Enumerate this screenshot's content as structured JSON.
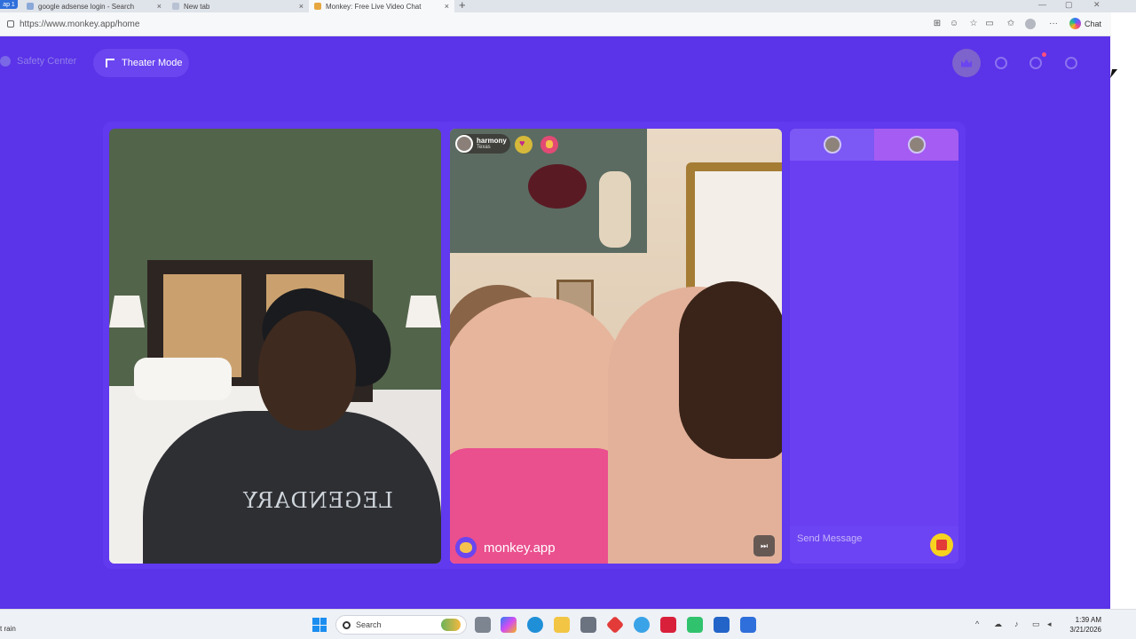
{
  "browser": {
    "tab_badge": "ap 1",
    "tabs": [
      {
        "title": "google adsense login - Search",
        "close": "×"
      },
      {
        "title": "New tab",
        "close": "×"
      },
      {
        "title": "Monkey: Free Live Video Chat",
        "close": "×"
      }
    ],
    "new_tab": "+",
    "url": "https://www.monkey.app/home",
    "chat_label": "Chat",
    "more": "···"
  },
  "page": {
    "safety_center": "Safety Center",
    "theater_mode": "Theater Mode",
    "remote_user": {
      "name": "harmony",
      "location": "Texas"
    },
    "watermark": "monkey.app",
    "next_symbol": "⏭",
    "shirt_text": "LEGENDARY",
    "chat": {
      "placeholder": "Send Message"
    }
  },
  "taskbar": {
    "weather": "t rain",
    "search": "Search",
    "time": "1:39 AM",
    "date": "3/21/2026"
  },
  "colors": {
    "page_bg": "#5b33e8",
    "accent": "#6a45f0",
    "chat_tab_active": "#a55cf2"
  }
}
